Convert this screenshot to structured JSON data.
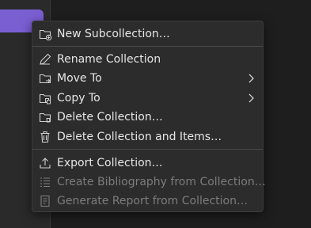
{
  "menu": {
    "items": [
      {
        "label": "New Subcollection…",
        "icon": "folder-plus-icon",
        "enabled": true,
        "submenu": false
      },
      {
        "label": "Rename Collection",
        "icon": "pencil-icon",
        "enabled": true,
        "submenu": false
      },
      {
        "label": "Move To",
        "icon": "folder-move-icon",
        "enabled": true,
        "submenu": true
      },
      {
        "label": "Copy To",
        "icon": "folder-copy-icon",
        "enabled": true,
        "submenu": true
      },
      {
        "label": "Delete Collection…",
        "icon": "folder-delete-icon",
        "enabled": true,
        "submenu": false
      },
      {
        "label": "Delete Collection and Items…",
        "icon": "trash-icon",
        "enabled": true,
        "submenu": false
      },
      {
        "label": "Export Collection…",
        "icon": "export-icon",
        "enabled": true,
        "submenu": false
      },
      {
        "label": "Create Bibliography from Collection…",
        "icon": "list-icon",
        "enabled": false,
        "submenu": false
      },
      {
        "label": "Generate Report from Collection…",
        "icon": "report-icon",
        "enabled": false,
        "submenu": false
      }
    ]
  },
  "colors": {
    "background": "#1e1e1e",
    "menu_background": "#2c2c2c",
    "text": "#e6e6e6",
    "disabled_text": "#7c7c7c",
    "selection": "#7a5fd3"
  }
}
